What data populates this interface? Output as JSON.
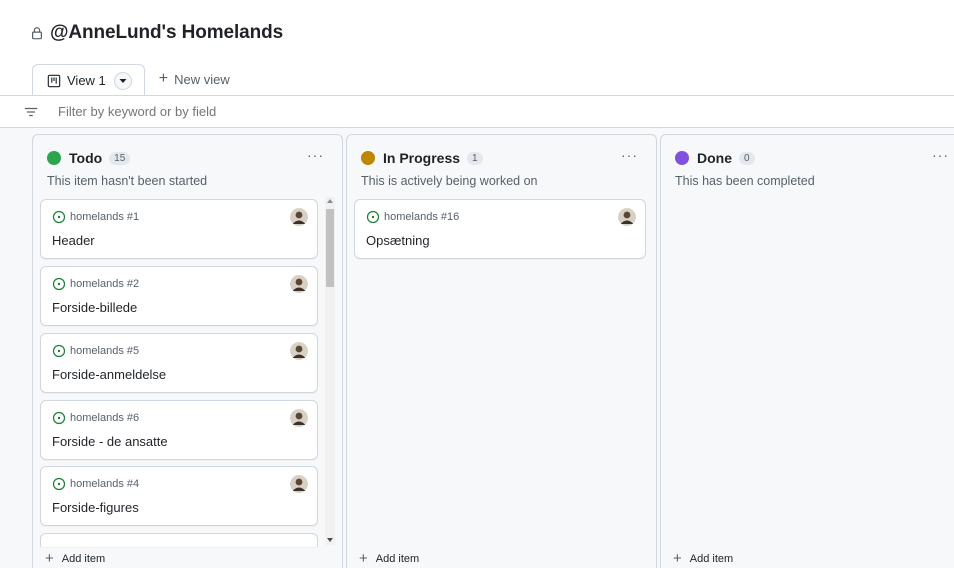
{
  "project": {
    "title": "@AnneLund's Homelands"
  },
  "tabs": {
    "active_label": "View 1",
    "new_view_label": "New view"
  },
  "filter": {
    "placeholder": "Filter by keyword or by field"
  },
  "colors": {
    "todo": "#2da44e",
    "in_progress": "#bf8700",
    "done": "#8250df",
    "issue_open": "#1a7f37"
  },
  "columns": [
    {
      "name": "Todo",
      "count": "15",
      "description": "This item hasn't been started",
      "add_label": "Add item",
      "cards": [
        {
          "ref": "homelands #1",
          "title": "Header"
        },
        {
          "ref": "homelands #2",
          "title": "Forside-billede"
        },
        {
          "ref": "homelands #5",
          "title": "Forside-anmeldelse"
        },
        {
          "ref": "homelands #6",
          "title": "Forside - de ansatte"
        },
        {
          "ref": "homelands #4",
          "title": "Forside-figures"
        }
      ]
    },
    {
      "name": "In Progress",
      "count": "1",
      "description": "This is actively being worked on",
      "add_label": "Add item",
      "cards": [
        {
          "ref": "homelands #16",
          "title": "Opsætning"
        }
      ]
    },
    {
      "name": "Done",
      "count": "0",
      "description": "This has been completed",
      "add_label": "Add item",
      "cards": []
    }
  ]
}
